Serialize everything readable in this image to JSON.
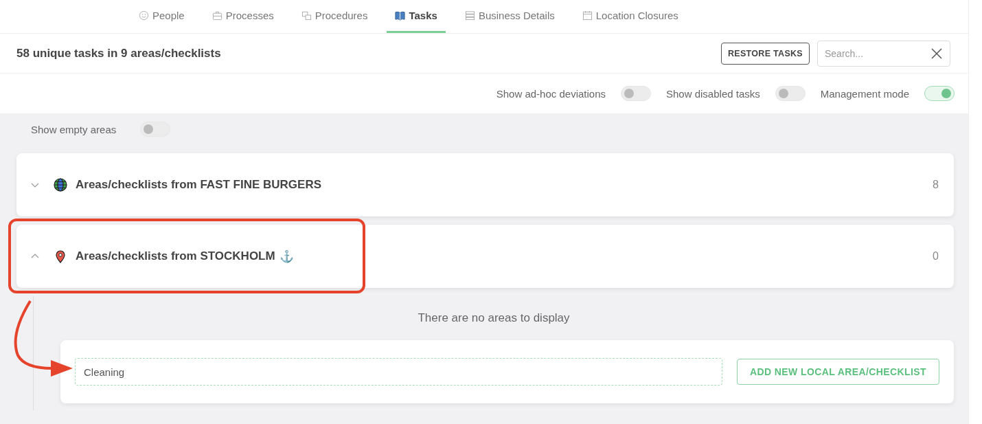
{
  "tabs": [
    {
      "label": "People",
      "selected": false
    },
    {
      "label": "Processes",
      "selected": false
    },
    {
      "label": "Procedures",
      "selected": false
    },
    {
      "label": "Tasks",
      "selected": true
    },
    {
      "label": "Business Details",
      "selected": false
    },
    {
      "label": "Location Closures",
      "selected": false
    }
  ],
  "header": {
    "summary": "58 unique tasks in 9 areas/checklists",
    "restore_button": "RESTORE TASKS",
    "search": {
      "placeholder": "Search..."
    }
  },
  "filters": [
    {
      "label": "Show ad-hoc deviations",
      "on": false
    },
    {
      "label": "Show disabled tasks",
      "on": false
    },
    {
      "label": "Management mode",
      "on": true
    }
  ],
  "empty_areas": {
    "label": "Show empty areas",
    "on": false
  },
  "sections": [
    {
      "kind": "global",
      "title": "Areas/checklists from FAST FINE BURGERS",
      "count": "8",
      "expanded": false,
      "highlighted": false
    },
    {
      "kind": "local",
      "title": "Areas/checklists from STOCKHOLM",
      "anchor": "⚓",
      "count": "0",
      "expanded": true,
      "highlighted": true,
      "empty_message": "There are no areas to display",
      "new_area": {
        "value": "Cleaning",
        "button": "ADD NEW LOCAL AREA/CHECKLIST"
      }
    }
  ]
}
